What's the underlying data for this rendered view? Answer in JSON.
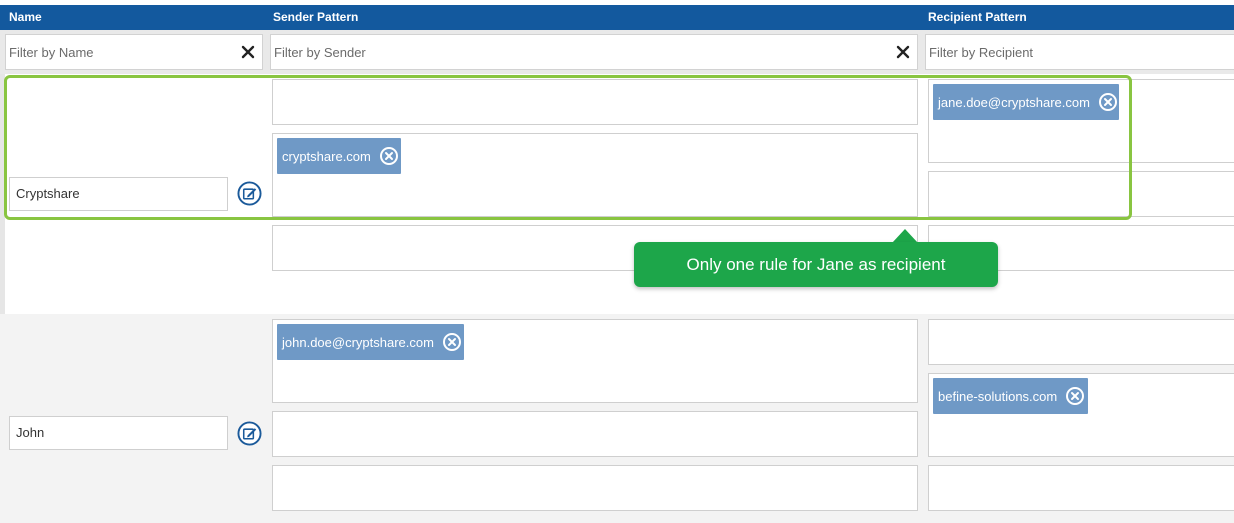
{
  "header": {
    "name": "Name",
    "sender": "Sender Pattern",
    "recipient": "Recipient Pattern"
  },
  "filters": {
    "name_placeholder": "Filter by Name",
    "sender_placeholder": "Filter by Sender",
    "recipient_placeholder": "Filter by Recipient"
  },
  "rows": [
    {
      "name": "Cryptshare",
      "sender_chips": [
        "cryptshare.com"
      ],
      "recipient_chips": [
        "jane.doe@cryptshare.com"
      ]
    },
    {
      "name": "John",
      "sender_chips": [
        "john.doe@cryptshare.com"
      ],
      "recipient_chips": [
        "befine-solutions.com"
      ]
    }
  ],
  "tooltip": "Only one rule for Jane as recipient",
  "colors": {
    "header": "#13599e",
    "chip": "#6f99c6",
    "highlight": "#89c541",
    "tooltip": "#1da64a"
  }
}
